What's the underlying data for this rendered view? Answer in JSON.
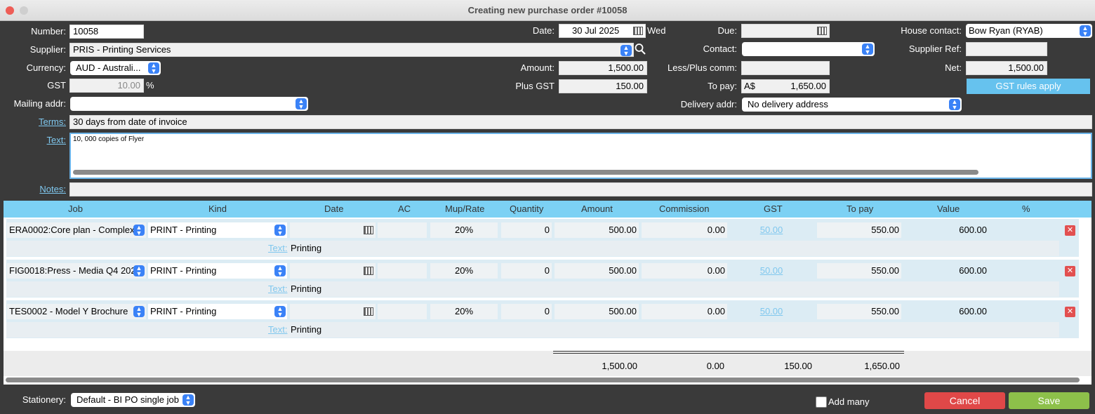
{
  "window": {
    "title": "Creating new purchase order #10058"
  },
  "header": {
    "number_label": "Number:",
    "number": "10058",
    "supplier_label": "Supplier:",
    "supplier": "PRIS - Printing Services",
    "currency_label": "Currency:",
    "currency": "AUD - Australi...",
    "gst_label": "GST",
    "gst": "10.00",
    "gst_unit": "%",
    "mailing_label": "Mailing addr:",
    "mailing": "",
    "terms_label": "Terms:",
    "terms": "30 days from date of invoice",
    "text_label": "Text:",
    "text": "10, 000 copies of Flyer",
    "notes_label": "Notes:",
    "notes": "",
    "date_label": "Date:",
    "date": "30 Jul 2025",
    "weekday": "Wed",
    "amount_label": "Amount:",
    "amount": "1,500.00",
    "plus_gst_label": "Plus GST",
    "plus_gst": "150.00",
    "due_label": "Due:",
    "due": "",
    "contact_label": "Contact:",
    "contact": "",
    "less_plus_label": "Less/Plus comm:",
    "less_plus": "",
    "to_pay_label": "To pay:",
    "to_pay_currency": "A$",
    "to_pay": "1,650.00",
    "delivery_label": "Delivery addr:",
    "delivery": "No delivery address",
    "house_label": "House contact:",
    "house": "Bow Ryan (RYAB)",
    "supref_label": "Supplier Ref:",
    "supref": "",
    "net_label": "Net:",
    "net": "1,500.00",
    "gst_rules_button": "GST rules apply"
  },
  "columns": [
    "Job",
    "Kind",
    "Date",
    "AC",
    "Mup/Rate",
    "Quantity",
    "Amount",
    "Commission",
    "GST",
    "To pay",
    "Value",
    "%"
  ],
  "rows": [
    {
      "job": "ERA0002:Core plan - Complex",
      "kind": "PRINT -  Printing",
      "date": "",
      "ac": "",
      "mup": "20%",
      "qty": "0",
      "amount": "500.00",
      "commission": "0.00",
      "gst": "50.00",
      "to_pay": "550.00",
      "value": "600.00",
      "text_label": "Text:",
      "text": "Printing"
    },
    {
      "job": "FIG0018:Press - Media Q4 202",
      "kind": "PRINT - Printing",
      "date": "",
      "ac": "",
      "mup": "20%",
      "qty": "0",
      "amount": "500.00",
      "commission": "0.00",
      "gst": "50.00",
      "to_pay": "550.00",
      "value": "600.00",
      "text_label": "Text:",
      "text": "Printing"
    },
    {
      "job": "TES0002 - Model Y Brochure",
      "kind": "PRINT -  Printing",
      "date": "",
      "ac": "",
      "mup": "20%",
      "qty": "0",
      "amount": "500.00",
      "commission": "0.00",
      "gst": "50.00",
      "to_pay": "550.00",
      "value": "600.00",
      "text_label": "Text:",
      "text": "Printing"
    }
  ],
  "totals": {
    "amount": "1,500.00",
    "commission": "0.00",
    "gst": "150.00",
    "to_pay": "1,650.00"
  },
  "footer": {
    "stationery_label": "Stationery:",
    "stationery": "Default - BI PO single job",
    "add_many": "Add many",
    "cancel": "Cancel",
    "save": "Save"
  },
  "colors": {
    "accent": "#7cd1f4",
    "cancel": "#e04848",
    "save": "#8dc04a",
    "select_stepper": "#3a82f7"
  }
}
